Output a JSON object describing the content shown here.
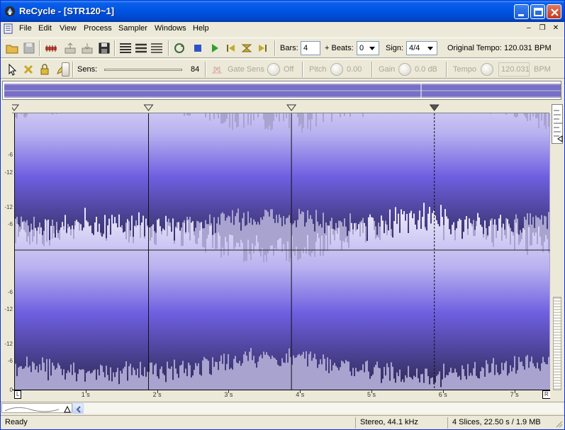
{
  "window": {
    "title": "ReCycle - [STR120~1]",
    "title_color": "#0054E3"
  },
  "menu": {
    "items": [
      "File",
      "Edit",
      "View",
      "Process",
      "Sampler",
      "Windows",
      "Help"
    ]
  },
  "toolbar1": {
    "bars_label": "Bars:",
    "bars_value": "4",
    "beats_label": "+ Beats:",
    "beats_value": "0",
    "sign_label": "Sign:",
    "sign_value": "4/4",
    "tempo_label": "Original Tempo:",
    "tempo_value": "120.031 BPM"
  },
  "toolbar2": {
    "sens_label": "Sens:",
    "sens_value": "84",
    "sens_level": 0.84,
    "gate_label": "Gate Sens",
    "gate_value": "Off",
    "pitch_label": "Pitch",
    "pitch_value": "0.00",
    "gain_label": "Gain",
    "gain_value": "0.0 dB",
    "tempo_label": "Tempo",
    "tempo_value": "120.031",
    "bpm_label": "BPM"
  },
  "editor": {
    "db_labels_top": [
      "0",
      "-6",
      "-12",
      "-12",
      "-6"
    ],
    "db_labels_bottom": [
      "-6",
      "-12",
      "-12",
      "-6",
      "0"
    ],
    "ruler_start": "L",
    "ruler_end": "R",
    "ruler_labels": [
      "1 s",
      "2 s",
      "3 s",
      "4 s",
      "5 s",
      "6 s",
      "7 s"
    ],
    "duration_s": 7.5,
    "slice_times_s": [
      0,
      1.88,
      3.88,
      5.88
    ],
    "wave_color": "#6E5FE0",
    "background_color": "#A8A3CF"
  },
  "status": {
    "ready": "Ready",
    "format": "Stereo, 44.1 kHz",
    "info": "4 Slices, 22.50 s / 1.9 MB"
  }
}
